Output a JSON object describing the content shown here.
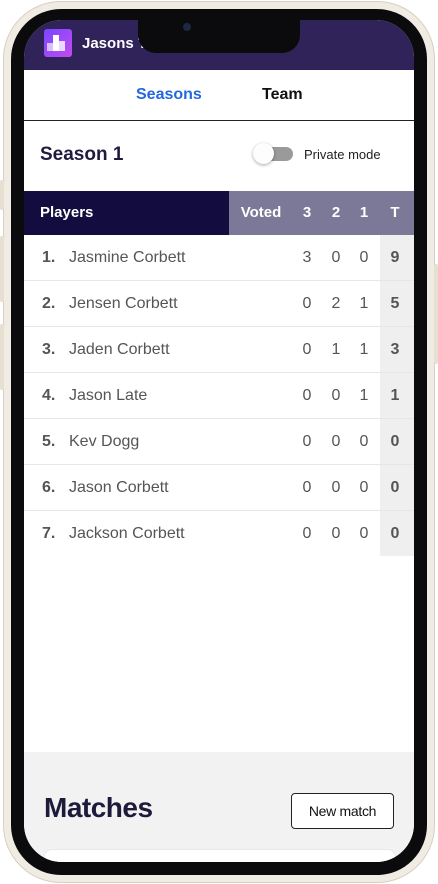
{
  "app": {
    "title": "Jasons Te"
  },
  "tabs": [
    {
      "label": "Seasons",
      "active": true
    },
    {
      "label": "Team",
      "active": false
    }
  ],
  "season": {
    "title": "Season 1",
    "private_mode_label": "Private mode",
    "private_mode_on": false
  },
  "table": {
    "headers": {
      "players": "Players",
      "voted": "Voted",
      "col3": "3",
      "col2": "2",
      "col1": "1",
      "total": "T"
    },
    "rows": [
      {
        "rank": "1.",
        "name": "Jasmine Corbett",
        "three": "3",
        "two": "0",
        "one": "0",
        "total": "9"
      },
      {
        "rank": "2.",
        "name": "Jensen Corbett",
        "three": "0",
        "two": "2",
        "one": "1",
        "total": "5"
      },
      {
        "rank": "3.",
        "name": "Jaden Corbett",
        "three": "0",
        "two": "1",
        "one": "1",
        "total": "3"
      },
      {
        "rank": "4.",
        "name": "Jason Late",
        "three": "0",
        "two": "0",
        "one": "1",
        "total": "1"
      },
      {
        "rank": "5.",
        "name": "Kev Dogg",
        "three": "0",
        "two": "0",
        "one": "0",
        "total": "0"
      },
      {
        "rank": "6.",
        "name": "Jason Corbett",
        "three": "0",
        "two": "0",
        "one": "0",
        "total": "0"
      },
      {
        "rank": "7.",
        "name": "Jackson Corbett",
        "three": "0",
        "two": "0",
        "one": "0",
        "total": "0"
      }
    ]
  },
  "matches": {
    "title": "Matches",
    "new_match_label": "New match"
  },
  "colors": {
    "header_bg": "#2f2359",
    "tab_active": "#2467e0",
    "players_header_bg": "#120d3e",
    "stats_header_bg": "#7c7897",
    "phone_frame": "#f1ece3"
  }
}
